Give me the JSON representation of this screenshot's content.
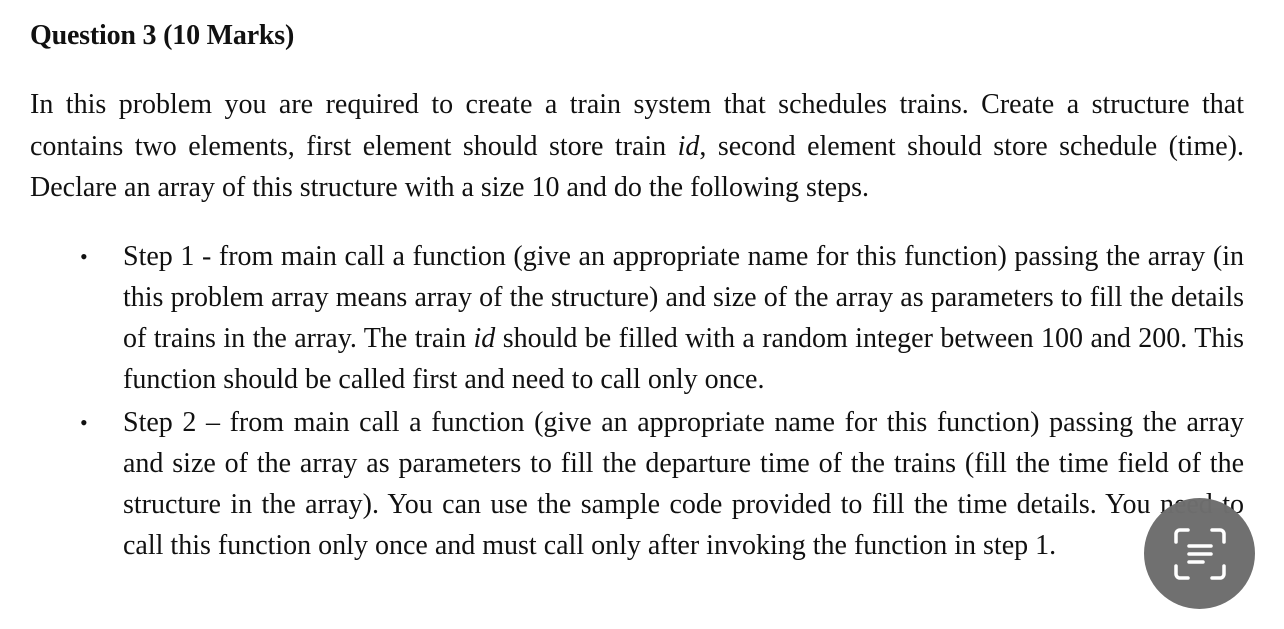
{
  "document": {
    "title": "Question 3 (10 Marks)",
    "intro": {
      "part1": "In this problem you are required to create a train system that schedules trains. Create a structure that contains two elements, first element should store train ",
      "italic1": "id",
      "part2": ", second element should store schedule (time).  Declare an array of this structure with a size 10 and do the following steps."
    },
    "steps": [
      {
        "bullet": "•",
        "part1": "Step 1 - from main call a function (give an appropriate name for this function) passing the array (in this problem array means array of the structure) and size of the array as parameters to fill the details of trains in the array. The train ",
        "italic1": "id",
        "part2": " should be filled with a random integer between 100 and 200. This function should be called first and need to call only once."
      },
      {
        "bullet": "•",
        "text": "Step 2 – from main call a function (give an appropriate name for this function) passing the array and size of the array as parameters to fill the departure time of the trains (fill the time field of the structure in the array). You can use the sample code provided to fill the time details. You need to call this function only once and must call only after invoking the function in step 1."
      }
    ]
  },
  "overlay": {
    "scan_button_icon": "scan-text-icon",
    "color": "#6e6e6e"
  }
}
